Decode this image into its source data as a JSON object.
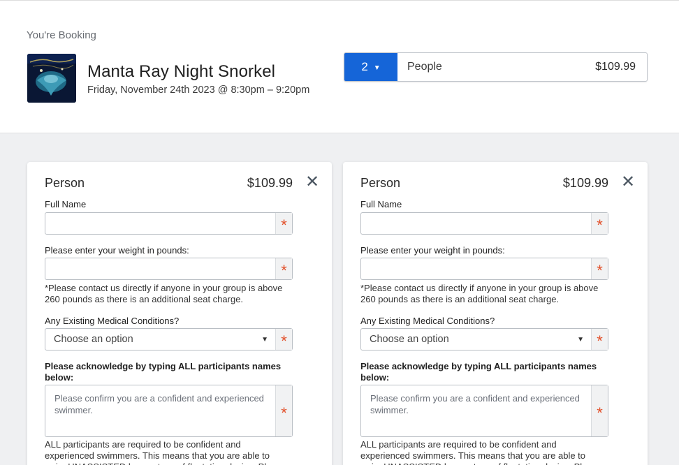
{
  "booking": {
    "label": "You're Booking",
    "title": "Manta Ray Night Snorkel",
    "date_time": "Friday, November 24th 2023 @ 8:30pm – 9:20pm",
    "quantity": "2",
    "people_label": "People",
    "people_price": "$109.99"
  },
  "persons": [
    {
      "title": "Person",
      "price": "$109.99",
      "full_name_label": "Full Name",
      "full_name_value": "",
      "weight_label": "Please enter your weight in pounds:",
      "weight_value": "",
      "weight_note": "*Please contact us directly if anyone in your group is above 260 pounds as there is an additional seat charge.",
      "medical_label": "Any Existing Medical Conditions?",
      "medical_selected": "Choose an option",
      "ack_label": "Please acknowledge by typing ALL participants names below:",
      "ack_placeholder": "Please confirm you are a confident and experienced swimmer.",
      "swim_note": "ALL participants are required to be confident and experienced swimmers. This means that you are able to swim UNASSISTED by any type of floatation device. Pl"
    },
    {
      "title": "Person",
      "price": "$109.99",
      "full_name_label": "Full Name",
      "full_name_value": "",
      "weight_label": "Please enter your weight in pounds:",
      "weight_value": "",
      "weight_note": "*Please contact us directly if anyone in your group is above 260 pounds as there is an additional seat charge.",
      "medical_label": "Any Existing Medical Conditions?",
      "medical_selected": "Choose an option",
      "ack_label": "Please acknowledge by typing ALL participants names below:",
      "ack_placeholder": "Please confirm you are a confident and experienced swimmer.",
      "swim_note": "ALL participants are required to be confident and experienced swimmers. This means that you are able to swim UNASSISTED by any type of floatation device. Pl"
    }
  ],
  "icons": {
    "dropdown": "caret-down-icon",
    "close": "close-icon",
    "required": "asterisk-icon"
  },
  "colors": {
    "accent": "#1565d8",
    "required": "#e2502a"
  }
}
